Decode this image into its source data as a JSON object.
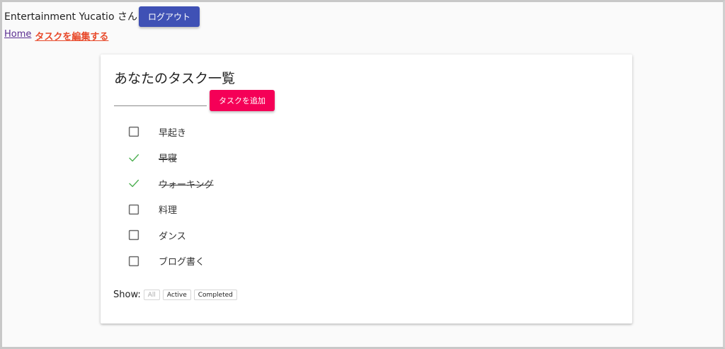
{
  "header": {
    "username": "Entertainment Yucatio さん",
    "logout_label": "ログアウト",
    "accent_color": "#3f51b5"
  },
  "breadcrumb": {
    "home": "Home",
    "edit": "タスクを編集する"
  },
  "card": {
    "title": "あなたのタスク一覧",
    "input_placeholder": "",
    "input_value": "",
    "add_label": "タスクを追加",
    "add_color": "#f50057"
  },
  "todos": [
    {
      "label": "早起き",
      "completed": false
    },
    {
      "label": "早寝",
      "completed": true
    },
    {
      "label": "ウォーキング",
      "completed": true
    },
    {
      "label": "料理",
      "completed": false
    },
    {
      "label": "ダンス",
      "completed": false
    },
    {
      "label": "ブログ書く",
      "completed": false
    }
  ],
  "filters": {
    "show_label": "Show:",
    "items": [
      {
        "label": "All",
        "disabled": true
      },
      {
        "label": "Active",
        "disabled": false
      },
      {
        "label": "Completed",
        "disabled": false
      }
    ]
  },
  "icons": {
    "unchecked": "checkbox-empty-icon",
    "checked": "checkmark-icon",
    "check_color": "#4caf50"
  }
}
